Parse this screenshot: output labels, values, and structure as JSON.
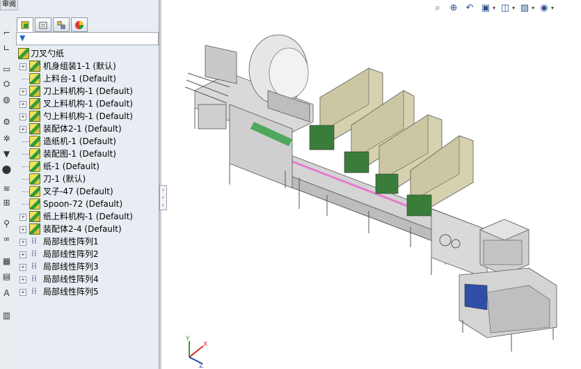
{
  "review_tab": "审阅",
  "left_toolbar": [
    "measure-icon",
    "sketch-icon",
    "display-icon",
    "assembly-icon",
    "globe-icon",
    "settings-icon",
    "gear-icon",
    "funnel-icon",
    "location-icon",
    "spring-icon",
    "link-icon",
    "search-icon",
    "binoculars-icon",
    "excel-icon",
    "print-icon",
    "text-icon",
    "chart-icon"
  ],
  "fm_tabs": [
    "feature-manager-tab",
    "property-manager-tab",
    "configuration-manager-tab",
    "display-manager-tab"
  ],
  "tree": {
    "root": "刀叉勺纸",
    "items": [
      {
        "label": "机身组装1-1 (默认)",
        "kind": "asm",
        "expand": true
      },
      {
        "label": "上料台-1 (Default)",
        "kind": "part",
        "expand": false
      },
      {
        "label": "刀上料机构-1 (Default)",
        "kind": "asm",
        "expand": true
      },
      {
        "label": "叉上料机构-1 (Default)",
        "kind": "asm",
        "expand": true
      },
      {
        "label": "勺上料机构-1 (Default)",
        "kind": "asm",
        "expand": true
      },
      {
        "label": "装配体2-1 (Default)",
        "kind": "asm",
        "expand": true
      },
      {
        "label": "造纸机-1 (Default)",
        "kind": "part",
        "expand": false
      },
      {
        "label": "装配图-1 (Default)",
        "kind": "part",
        "expand": false
      },
      {
        "label": "纸-1 (Default)",
        "kind": "part",
        "expand": false
      },
      {
        "label": "刀-1 (默认)",
        "kind": "part",
        "expand": false
      },
      {
        "label": "叉子-47 (Default)",
        "kind": "part",
        "expand": false
      },
      {
        "label": "Spoon-72 (Default)",
        "kind": "part",
        "expand": false
      },
      {
        "label": "纸上料机构-1 (Default)",
        "kind": "asm",
        "expand": true
      },
      {
        "label": "装配体2-4 (Default)",
        "kind": "asm",
        "expand": true
      },
      {
        "label": "局部线性阵列1",
        "kind": "pattern",
        "expand": true
      },
      {
        "label": "局部线性阵列2",
        "kind": "pattern",
        "expand": true
      },
      {
        "label": "局部线性阵列3",
        "kind": "pattern",
        "expand": true
      },
      {
        "label": "局部线性阵列4",
        "kind": "pattern",
        "expand": true
      },
      {
        "label": "局部线性阵列5",
        "kind": "pattern",
        "expand": true
      }
    ]
  },
  "hud": [
    "zoom-to-fit-icon",
    "zoom-area-icon",
    "previous-view-icon",
    "section-view-icon",
    "view-orientation-icon",
    "display-style-icon",
    "hide-show-icon"
  ],
  "axes": {
    "x": "X",
    "y": "Y",
    "z": "Z"
  },
  "colors": {
    "panel": "#e8edf3",
    "machine_gray": "#c9c9c9",
    "hopper": "#d6d2b0",
    "accent_green": "#2e9c3e",
    "accent_pink": "#e57ad0",
    "screen_blue": "#2f4ea8"
  }
}
